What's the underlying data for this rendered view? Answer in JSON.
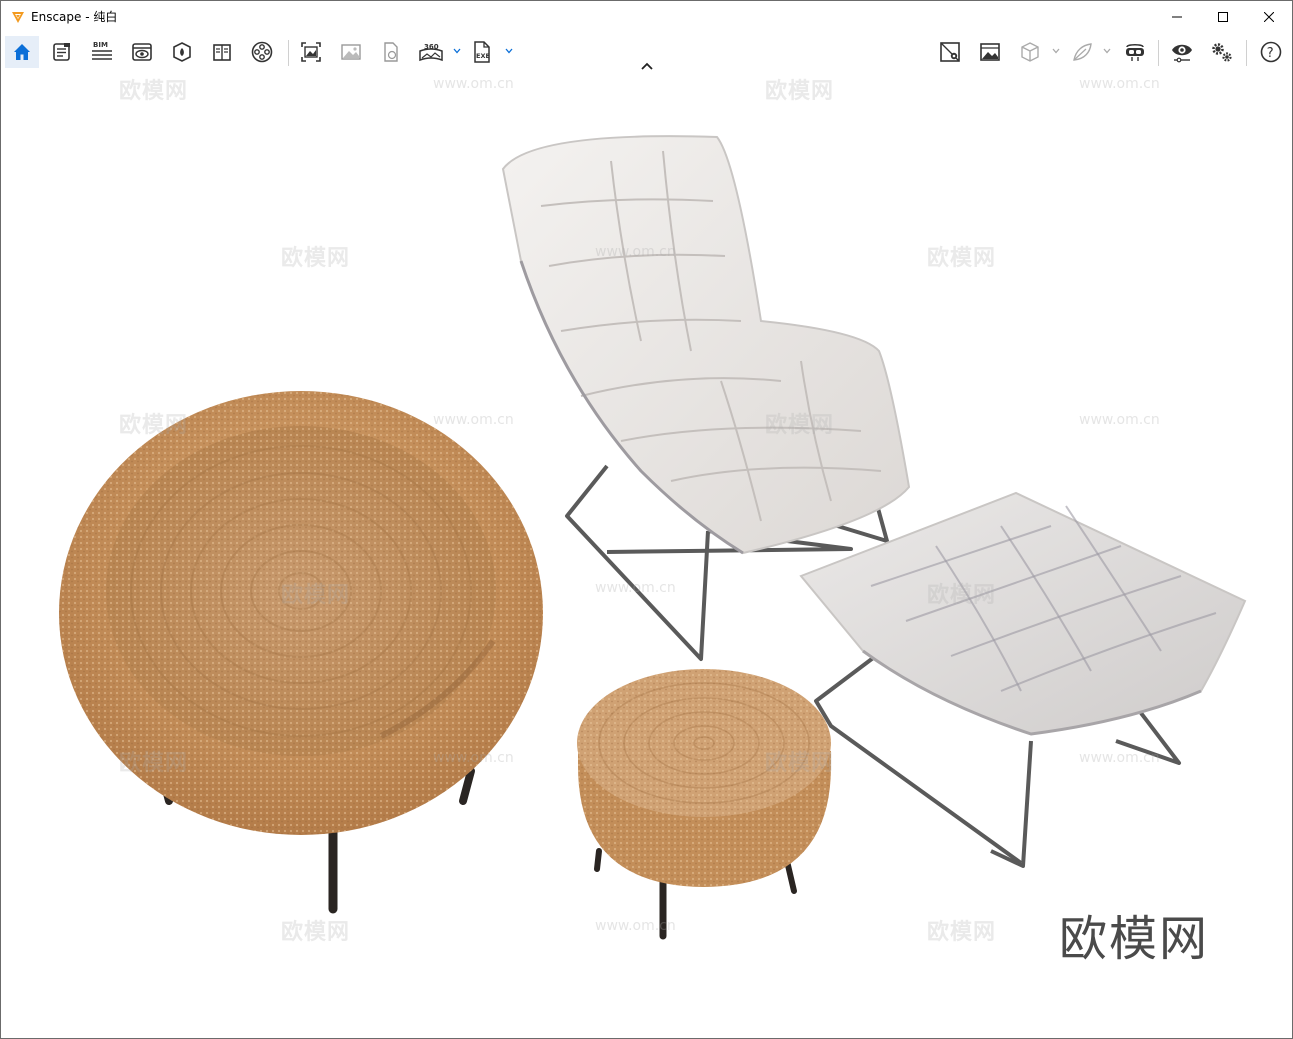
{
  "window": {
    "app_name": "Enscape",
    "title": "Enscape - 纯白"
  },
  "window_controls": {
    "minimize": "minimize",
    "maximize": "maximize",
    "close": "close"
  },
  "toolbar": {
    "left": [
      {
        "id": "home",
        "icon": "home-icon",
        "active": true
      },
      {
        "id": "news",
        "icon": "news-icon"
      },
      {
        "id": "bim",
        "icon": "bim-icon",
        "text": "BIM"
      },
      {
        "id": "view",
        "icon": "view-management-icon"
      },
      {
        "id": "asset",
        "icon": "asset-library-icon"
      },
      {
        "id": "materials",
        "icon": "material-editor-icon"
      },
      {
        "id": "video",
        "icon": "video-editor-icon"
      },
      {
        "id": "screenshot",
        "icon": "screenshot-icon"
      },
      {
        "id": "batch",
        "icon": "batch-render-icon"
      },
      {
        "id": "web",
        "icon": "web-standalone-icon"
      },
      {
        "id": "pano",
        "icon": "panorama-icon",
        "text": "360"
      },
      {
        "id": "exe",
        "icon": "exe-export-icon",
        "text": "EXE"
      }
    ],
    "right": [
      {
        "id": "safe-frame",
        "icon": "safe-frame-icon"
      },
      {
        "id": "render-export",
        "icon": "render-export-icon"
      },
      {
        "id": "cube",
        "icon": "view-cube-icon"
      },
      {
        "id": "leaf",
        "icon": "vegetation-icon"
      },
      {
        "id": "vr",
        "icon": "vr-headset-icon"
      },
      {
        "id": "visual-settings",
        "icon": "eye-settings-icon"
      },
      {
        "id": "settings",
        "icon": "gear-settings-icon"
      },
      {
        "id": "help",
        "icon": "help-icon",
        "text": "?"
      }
    ]
  },
  "watermarks": {
    "brand": "欧模网",
    "site": "www.om.cn"
  },
  "colors": {
    "accent": "#0b6fd8",
    "rattan": "#c8935e",
    "leather": "#e9e6e4",
    "frame": "#5a5a5a"
  }
}
